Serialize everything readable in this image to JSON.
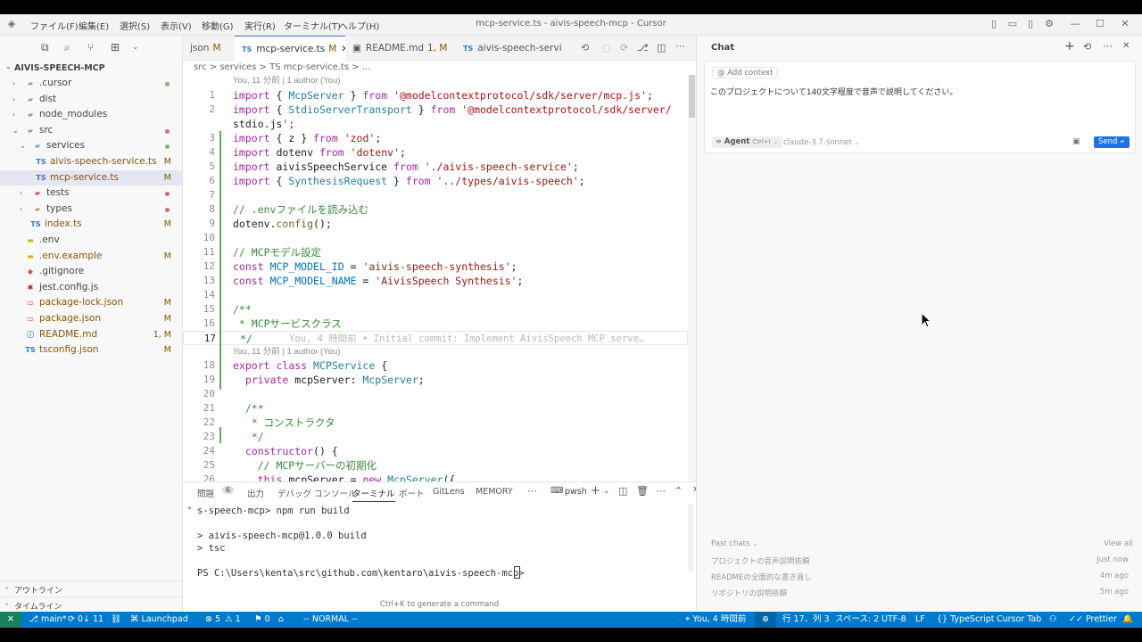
{
  "titlebar": {
    "menus": [
      "ファイル(F)",
      "編集(E)",
      "選択(S)",
      "表示(V)",
      "移動(G)",
      "実行(R)",
      "ターミナル(T)",
      "ヘルプ(H)"
    ],
    "title": "mcp-service.ts - aivis-speech-mcp - Cursor"
  },
  "explorer": {
    "root": "AIVIS-SPEECH-MCP",
    "items": [
      {
        "label": ".cursor",
        "badge": ""
      },
      {
        "label": "dist",
        "badge": ""
      },
      {
        "label": "node_modules",
        "badge": ""
      },
      {
        "label": "src",
        "badge": ""
      },
      {
        "label": "services",
        "badge": ""
      },
      {
        "label": "aivis-speech-service.ts",
        "badge": "M"
      },
      {
        "label": "mcp-service.ts",
        "badge": "M"
      },
      {
        "label": "tests",
        "badge": ""
      },
      {
        "label": "types",
        "badge": ""
      },
      {
        "label": "index.ts",
        "badge": "M"
      },
      {
        "label": ".env",
        "badge": ""
      },
      {
        "label": ".env.example",
        "badge": "M"
      },
      {
        "label": ".gitignore",
        "badge": ""
      },
      {
        "label": "jest.config.js",
        "badge": ""
      },
      {
        "label": "package-lock.json",
        "badge": "M"
      },
      {
        "label": "package.json",
        "badge": "M"
      },
      {
        "label": "README.md",
        "badge": "1, M"
      },
      {
        "label": "tsconfig.json",
        "badge": "M"
      }
    ],
    "outline": "アウトライン",
    "timeline": "タイムライン"
  },
  "tabs": [
    {
      "label": "json",
      "mod": "M"
    },
    {
      "label": "mcp-service.ts",
      "mod": "M"
    },
    {
      "label": "README.md",
      "mod": "1, M"
    },
    {
      "label": "aivis-speech-servic",
      "mod": ""
    }
  ],
  "breadcrumb": "src > services > TS mcp-service.ts > ...",
  "blame": {
    "top": "You, 11 分前 | 1 author (You)",
    "inline": "You, 4 時間前 • Initial commit: Implement AivisSpeech MCP serve…",
    "second": "You, 11 分前 | 1 author (You)"
  },
  "code_lines": [
    {
      "n": "1",
      "t": "import { McpServer } from '@modelcontextprotocol/sdk/server/mcp.js';"
    },
    {
      "n": "2",
      "t": "import { StdioServerTransport } from '@modelcontextprotocol/sdk/server/"
    },
    {
      "n": "",
      "t": "stdio.js';"
    },
    {
      "n": "3",
      "t": "import { z } from 'zod';"
    },
    {
      "n": "4",
      "t": "import dotenv from 'dotenv';"
    },
    {
      "n": "5",
      "t": "import aivisSpeechService from './aivis-speech-service';"
    },
    {
      "n": "6",
      "t": "import { SynthesisRequest } from '../types/aivis-speech';"
    },
    {
      "n": "7",
      "t": ""
    },
    {
      "n": "8",
      "t": "// .envファイルを読み込む"
    },
    {
      "n": "9",
      "t": "dotenv.config();"
    },
    {
      "n": "10",
      "t": ""
    },
    {
      "n": "11",
      "t": "// MCPモデル設定"
    },
    {
      "n": "12",
      "t": "const MCP_MODEL_ID = 'aivis-speech-synthesis';"
    },
    {
      "n": "13",
      "t": "const MCP_MODEL_NAME = 'AivisSpeech Synthesis';"
    },
    {
      "n": "14",
      "t": ""
    },
    {
      "n": "15",
      "t": "/**"
    },
    {
      "n": "16",
      "t": " * MCPサービスクラス"
    },
    {
      "n": "17",
      "t": " */"
    },
    {
      "n": "18",
      "t": "export class MCPService {"
    },
    {
      "n": "19",
      "t": "  private mcpServer: McpServer;"
    },
    {
      "n": "20",
      "t": ""
    },
    {
      "n": "21",
      "t": "  /**"
    },
    {
      "n": "22",
      "t": "   * コンストラクタ"
    },
    {
      "n": "23",
      "t": "   */"
    },
    {
      "n": "24",
      "t": "  constructor() {"
    },
    {
      "n": "25",
      "t": "    // MCPサーバーの初期化"
    },
    {
      "n": "26",
      "t": "    this.mcpServer = new McpServer({"
    }
  ],
  "panel": {
    "tabs": [
      "問題",
      "出力",
      "デバッグ コンソール",
      "ターミナル",
      "ポート",
      "GitLens",
      "MEMORY"
    ],
    "problems_count": "6",
    "shell": "pwsh",
    "terminal_lines": [
      "s-speech-mcp> npm run build",
      "",
      "> aivis-speech-mcp@1.0.0 build",
      "> tsc",
      "",
      "PS C:\\Users\\kenta\\src\\github.com\\kentaro\\aivis-speech-mcp> "
    ],
    "hint": "Ctrl+K to generate a command"
  },
  "chat": {
    "title": "Chat",
    "add_context": "Add context",
    "message": "このプロジェクトについて140文字程度で音声で説明してください。",
    "mode": "Agent",
    "mode_shortcut": "Ctrl+I",
    "model": "claude-3.7-sonnet",
    "send": "Send",
    "past_chats_label": "Past chats",
    "view_all": "View all",
    "past_chats": [
      {
        "title": "プロジェクトの音声説明依頼",
        "time": "Just now"
      },
      {
        "title": "READMEの全面的な書き直し",
        "time": "4m ago"
      },
      {
        "title": "リポジトリの説明依頼",
        "time": "5m ago"
      }
    ]
  },
  "statusbar": {
    "branch": "main*",
    "sync": "0↓ 11",
    "launchpad": "Launchpad",
    "errors": "5",
    "warnings": "1",
    "ports": "0",
    "vim_mode": "-- NORMAL --",
    "blame": "You, 4 時間前",
    "position": "行 17、列 3",
    "spaces": "スペース: 2",
    "encoding": "UTF-8",
    "eol": "LF",
    "language": "TypeScript",
    "cursor_tab": "Cursor Tab",
    "prettier": "Prettier"
  }
}
